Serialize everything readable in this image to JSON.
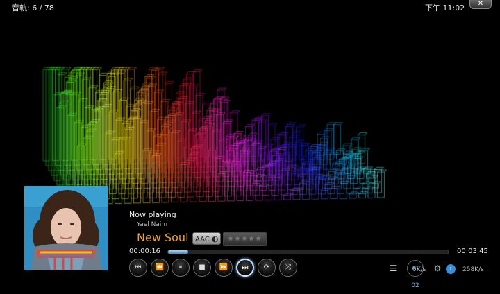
{
  "header": {
    "track_counter": "音軌: 6 / 78",
    "clock": "下午 11:02",
    "close_glyph": "✕"
  },
  "now_playing": {
    "heading": "Now playing",
    "artist": "Yael Naim",
    "title": "New Soul",
    "codec": "AAC",
    "rating_stars": "★★★★★",
    "rating": 0
  },
  "progress": {
    "elapsed": "00:00:16",
    "total": "00:03:45",
    "fraction": 0.071
  },
  "controls": [
    {
      "name": "previous-track-icon",
      "glyph": "⏮"
    },
    {
      "name": "rewind-icon",
      "glyph": "⏪"
    },
    {
      "name": "pause-icon",
      "glyph": "⏸"
    },
    {
      "name": "stop-icon",
      "glyph": "■"
    },
    {
      "name": "fast-forward-icon",
      "glyph": "⏩"
    },
    {
      "name": "next-track-icon",
      "glyph": "⏭"
    },
    {
      "name": "repeat-icon",
      "glyph": "⟳"
    },
    {
      "name": "shuffle-icon",
      "glyph": "⤮"
    }
  ],
  "system": {
    "playlist_glyph": "☰",
    "clock_small": "AT 02",
    "speed_down": "0K/s",
    "speed_up": "258K/s",
    "info_glyph": "i",
    "gear_glyph": "⚙"
  },
  "colors": {
    "title_orange": "#f2a12a",
    "progress_blue": "#5aa9e0"
  }
}
